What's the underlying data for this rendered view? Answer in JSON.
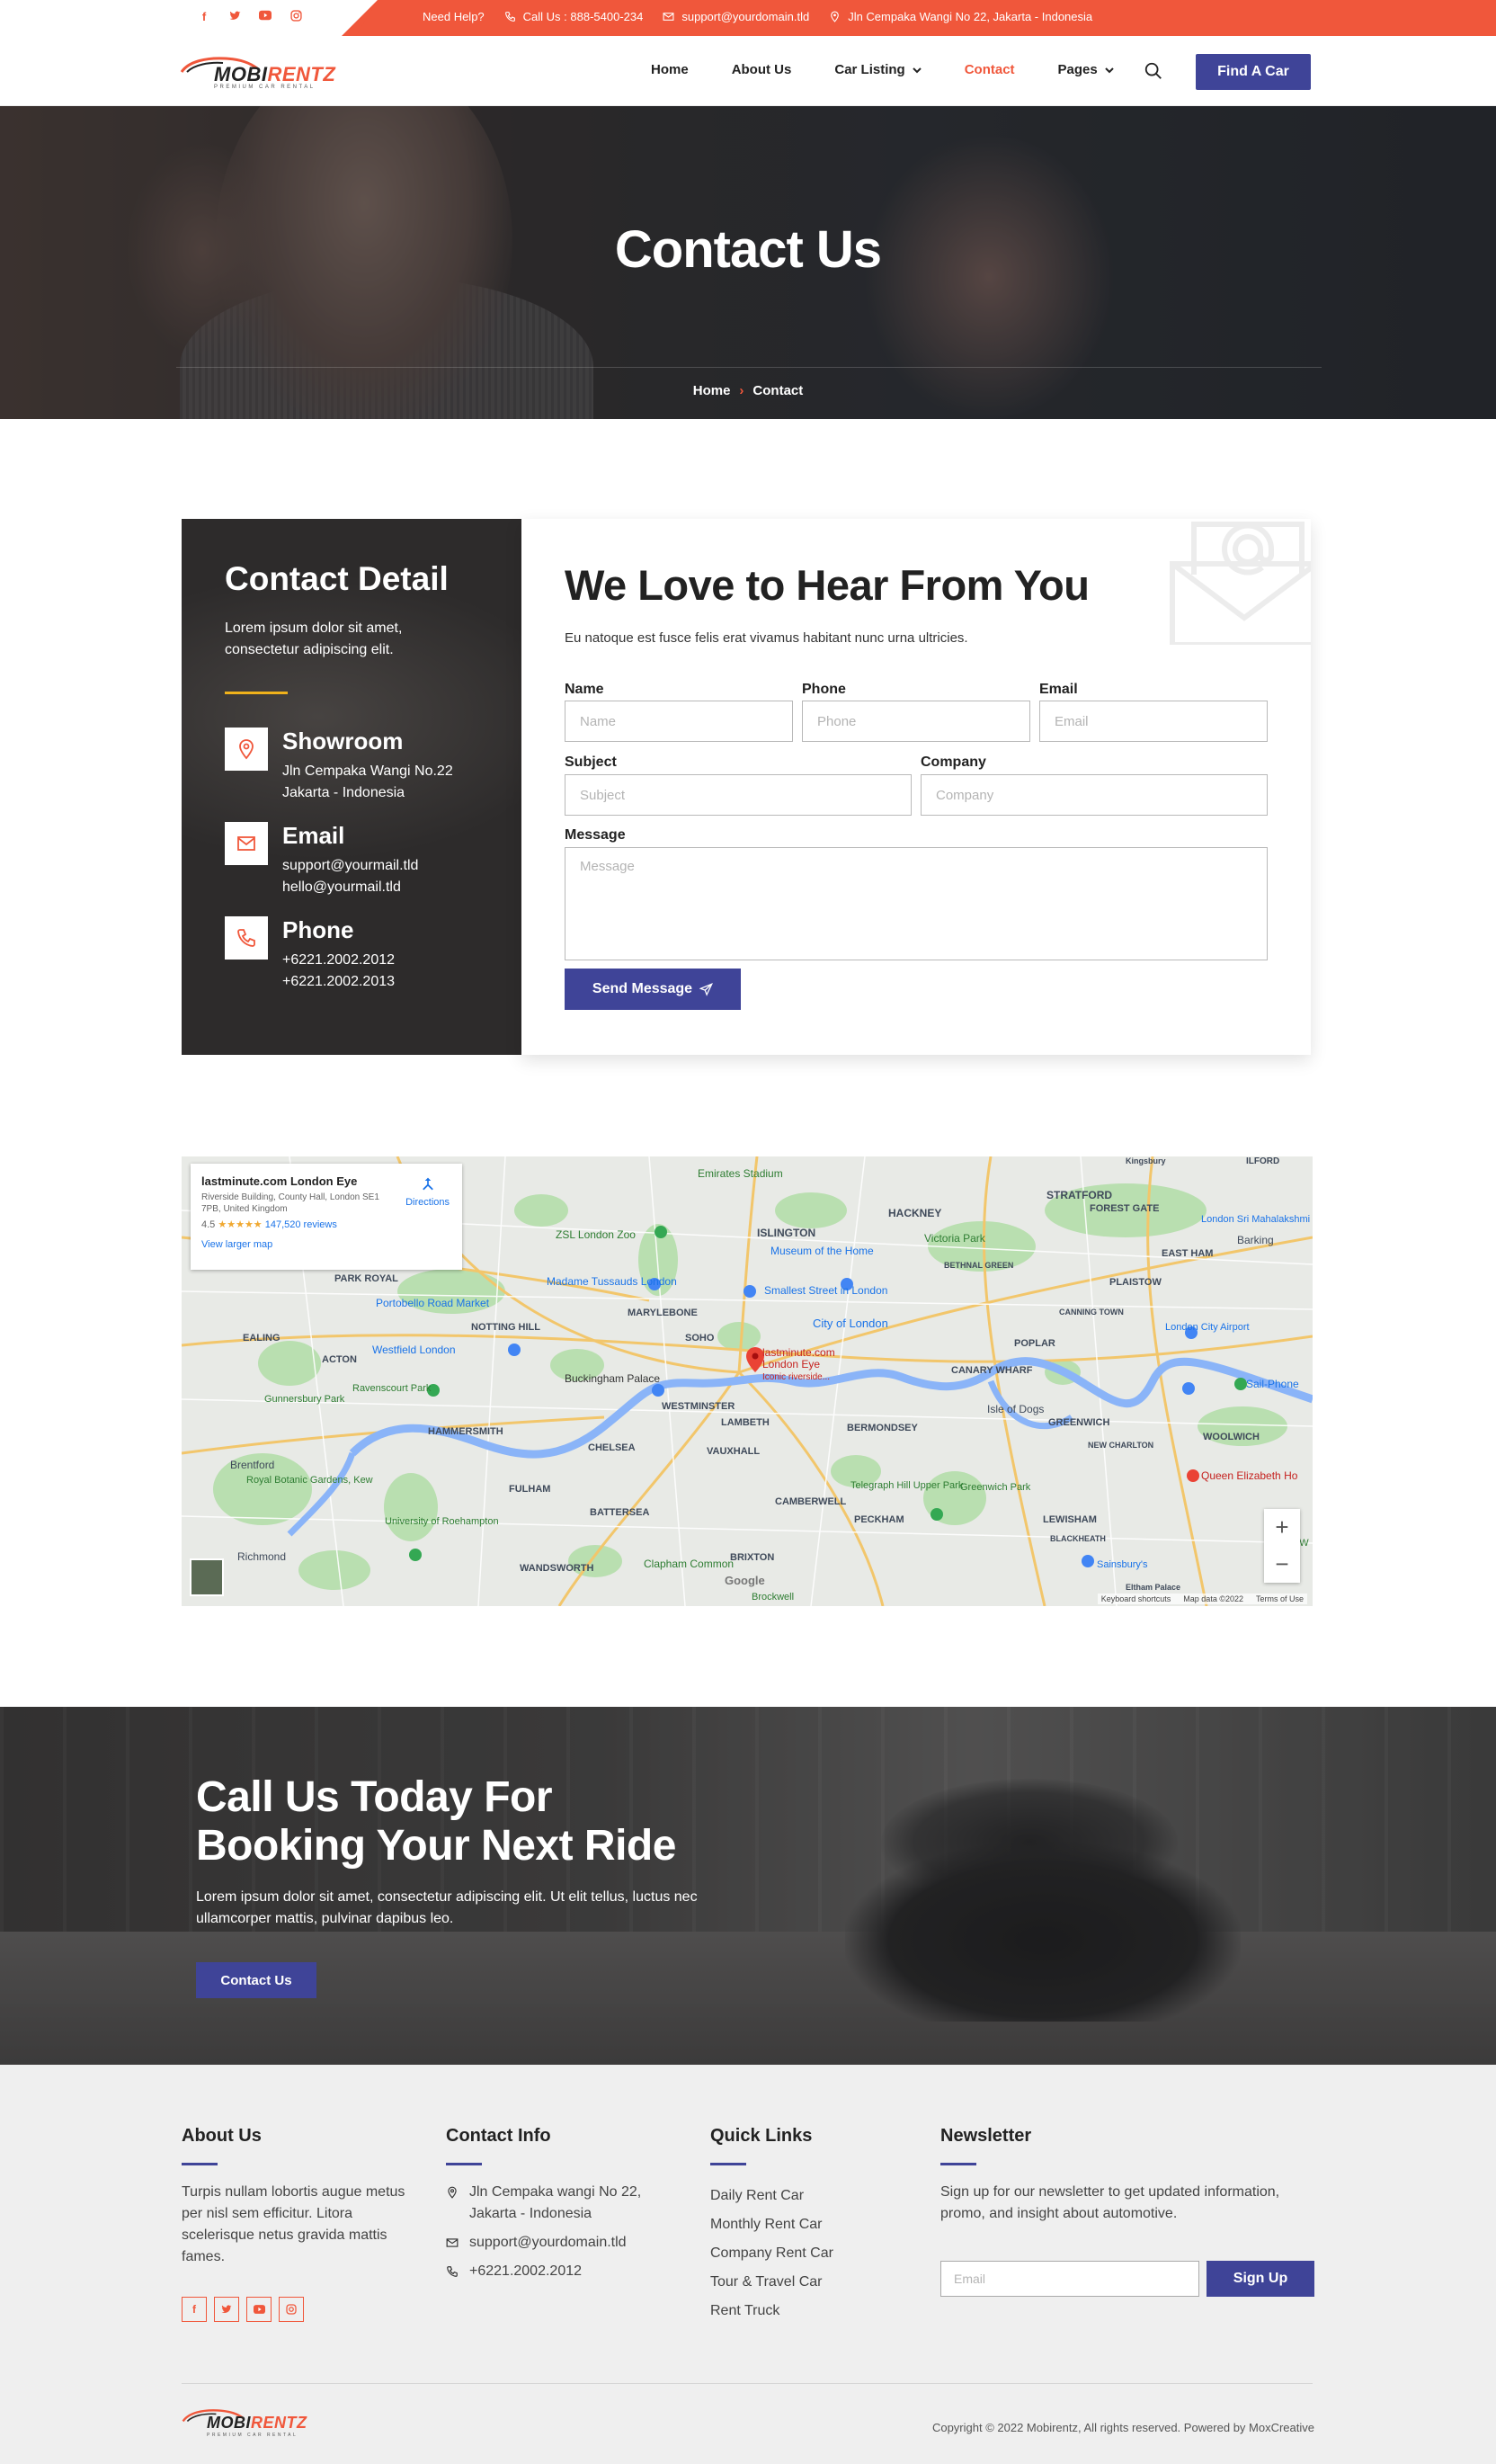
{
  "topbar": {
    "social": [
      "f",
      "t",
      "yt",
      "ig"
    ],
    "need_help": "Need Help?",
    "call": "Call Us : 888-5400-234",
    "email": "support@yourdomain.tld",
    "address": "Jln Cempaka Wangi No 22, Jakarta - Indonesia"
  },
  "nav": {
    "logo_a": "MOBI",
    "logo_b": "RENTZ",
    "logo_tag": "PREMIUM CAR RENTAL",
    "items": [
      "Home",
      "About Us",
      "Car Listing",
      "Contact",
      "Pages"
    ],
    "active": "Contact",
    "find_button": "Find A Car"
  },
  "hero": {
    "title": "Contact Us",
    "crumb_home": "Home",
    "crumb_sep": "›",
    "crumb_current": "Contact"
  },
  "contact_detail": {
    "title": "Contact Detail",
    "lead": "Lorem ipsum dolor sit amet, consectetur adipiscing elit.",
    "showroom_title": "Showroom",
    "showroom_line1": "Jln Cempaka Wangi No.22",
    "showroom_line2": "Jakarta - Indonesia",
    "email_title": "Email",
    "email_line1": "support@yourmail.tld",
    "email_line2": "hello@yourmail.tld",
    "phone_title": "Phone",
    "phone_line1": "+6221.2002.2012",
    "phone_line2": "+6221.2002.2013"
  },
  "form": {
    "title": "We Love to Hear From You",
    "subtitle": "Eu natoque est fusce felis erat vivamus habitant nunc urna ultricies.",
    "name_label": "Name",
    "name_placeholder": "Name",
    "phone_label": "Phone",
    "phone_placeholder": "Phone",
    "email_label": "Email",
    "email_placeholder": "Email",
    "subject_label": "Subject",
    "subject_placeholder": "Subject",
    "company_label": "Company",
    "company_placeholder": "Company",
    "message_label": "Message",
    "message_placeholder": "Message",
    "send_button": "Send Message"
  },
  "map": {
    "place_title": "lastminute.com London Eye",
    "place_address": "Riverside Building, County Hall, London SE1 7PB, United Kingdom",
    "rating": "4.5",
    "stars": "★★★★★",
    "reviews": "147,520 reviews",
    "larger_map": "View larger map",
    "directions": "Directions",
    "pin_label": "lastminute.com London Eye",
    "pin_sub": "Iconic riverside...",
    "labels": [
      "Emirates Stadium",
      "ISLINGTON",
      "HACKNEY",
      "STRATFORD",
      "FOREST GATE",
      "PARK ROYAL",
      "Museum of the Home",
      "Victoria Park",
      "EAST HAM",
      "ZSL London Zoo",
      "MARYLEBONE",
      "SOHO",
      "City of London",
      "POPLAR",
      "EALING",
      "ACTON",
      "NOTTING HILL",
      "Buckingham Palace",
      "WESTMINSTER",
      "CANARY WHARF",
      "HAMMERSMITH",
      "CHELSEA",
      "LAMBETH",
      "BERMONDSEY",
      "Isle of Dogs",
      "GREENWICH",
      "WOOLWICH",
      "Brentford",
      "FULHAM",
      "VAUXHALL",
      "BATTERSEA",
      "CAMBERWELL",
      "PECKHAM",
      "LEWISHAM",
      "Richmond",
      "WANDSWORTH",
      "BRIXTON",
      "Clapham Common",
      "Barking",
      "PLAISTOW",
      "Madame Tussauds London",
      "Westfield London",
      "Portobello Road Market",
      "Smallest Street in London",
      "Sail-Phone",
      "Queen Elizabeth Ho",
      "London City Airport",
      "Telegraph Hill Upper Park",
      "Greenwich Park",
      "Sainsbury's",
      "University of Roehampton",
      "Ravenscourt Park",
      "Gunnersbury Park",
      "Royal Botanic Gardens, Kew",
      "Brockwell",
      "NEW CHARLTON",
      "BLACKHEATH",
      "Oxleas W",
      "London Sri Mahalakshmi Temp",
      "ILFORD",
      "CANNING TOWN",
      "BETHNAL GREEN",
      "Kingsbury",
      "Eltham Palace"
    ],
    "zoom_in": "+",
    "zoom_out": "−",
    "footer_shortcuts": "Keyboard shortcuts",
    "footer_data": "Map data ©2022",
    "footer_terms": "Terms of Use",
    "google": "Google"
  },
  "cta": {
    "title_line1": "Call Us Today For",
    "title_line2": "Booking Your Next Ride",
    "text": "Lorem ipsum dolor sit amet, consectetur adipiscing elit. Ut elit tellus, luctus nec ullamcorper mattis, pulvinar dapibus leo.",
    "button": "Contact Us"
  },
  "footer": {
    "about_title": "About Us",
    "about_text": "Turpis nullam lobortis augue metus per nisl sem efficitur. Litora scelerisque netus gravida mattis fames.",
    "info_title": "Contact Info",
    "info_address": "Jln Cempaka wangi No 22, Jakarta - Indonesia",
    "info_email": "support@yourdomain.tld",
    "info_phone": "+6221.2002.2012",
    "links_title": "Quick Links",
    "links": [
      "Daily Rent Car",
      "Monthly Rent Car",
      "Company Rent Car",
      "Tour & Travel Car",
      "Rent Truck"
    ],
    "news_title": "Newsletter",
    "news_text": "Sign up for our newsletter to get updated information, promo, and insight about automotive.",
    "news_placeholder": "Email",
    "news_button": "Sign Up",
    "copyright": "Copyright © 2022 Mobirentz, All rights reserved. Powered by MoxCreative"
  },
  "colors": {
    "accent": "#f0573b",
    "primary": "#3f4498",
    "gold": "#f0b21b"
  }
}
